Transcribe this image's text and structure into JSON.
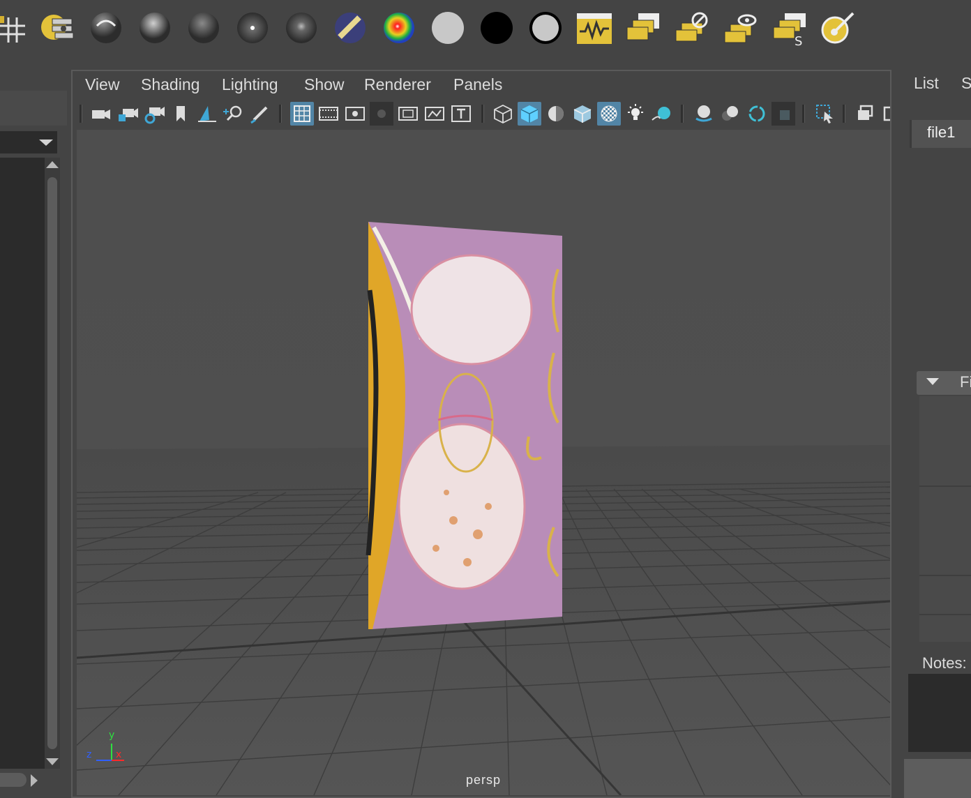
{
  "shelf": {
    "icons": [
      "grid-snap-icon",
      "attribute-editor-icon",
      "sphere-lambert-icon",
      "sphere-blinn-icon",
      "sphere-phong-icon",
      "sphere-phong-e-icon",
      "sphere-anisotropic-icon",
      "sphere-layered-icon",
      "ramp-shader-icon",
      "surface-shader-white-icon",
      "black-shader-icon",
      "outlined-shader-icon",
      "graph-editor-icon",
      "render-layer-icon",
      "render-layer-disable-icon",
      "render-layer-view-icon",
      "render-layer-settings-icon",
      "paint-tool-icon"
    ]
  },
  "viewport": {
    "menus": [
      "View",
      "Shading",
      "Lighting",
      "Show",
      "Renderer",
      "Panels"
    ],
    "camera_label": "persp",
    "axis": {
      "x": "x",
      "y": "y",
      "z": "z"
    },
    "colors": {
      "background": "#4f4f4f",
      "grid": "#3d3d3d",
      "selection": "#5285a6"
    }
  },
  "attribute_editor": {
    "menus": [
      "List",
      "S"
    ],
    "tab": "file1",
    "section": "Fi",
    "notes_label": "Notes:"
  }
}
